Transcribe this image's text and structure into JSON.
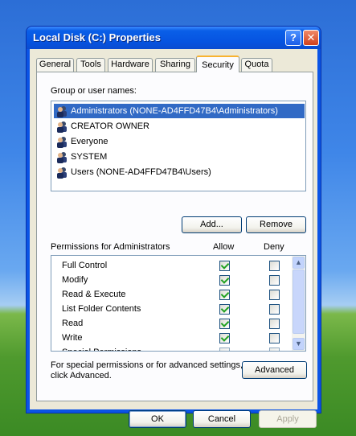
{
  "window": {
    "title": "Local Disk (C:) Properties",
    "help_glyph": "?",
    "close_glyph": "✕"
  },
  "tabs": [
    {
      "label": "General"
    },
    {
      "label": "Tools"
    },
    {
      "label": "Hardware"
    },
    {
      "label": "Sharing"
    },
    {
      "label": "Security",
      "active": true
    },
    {
      "label": "Quota"
    }
  ],
  "groups": {
    "label": "Group or user names:",
    "items": [
      {
        "name": "Administrators (NONE-AD4FFD47B4\\Administrators)",
        "selected": true
      },
      {
        "name": "CREATOR OWNER"
      },
      {
        "name": "Everyone"
      },
      {
        "name": "SYSTEM"
      },
      {
        "name": "Users (NONE-AD4FFD47B4\\Users)"
      }
    ],
    "add_label": "Add...",
    "remove_label": "Remove"
  },
  "permissions": {
    "label": "Permissions for Administrators",
    "allow_label": "Allow",
    "deny_label": "Deny",
    "rows": [
      {
        "name": "Full Control",
        "allow": true,
        "deny": false
      },
      {
        "name": "Modify",
        "allow": true,
        "deny": false
      },
      {
        "name": "Read & Execute",
        "allow": true,
        "deny": false
      },
      {
        "name": "List Folder Contents",
        "allow": true,
        "deny": false
      },
      {
        "name": "Read",
        "allow": true,
        "deny": false
      },
      {
        "name": "Write",
        "allow": true,
        "deny": false
      },
      {
        "name": "Special Permissions",
        "allow": false,
        "deny": false
      }
    ],
    "scroll_up": "▲",
    "scroll_down": "▼"
  },
  "advanced": {
    "text_line1": "For special permissions or for advanced settings,",
    "text_line2": "click Advanced.",
    "button_label": "Advanced"
  },
  "footer": {
    "ok_label": "OK",
    "cancel_label": "Cancel",
    "apply_label": "Apply"
  },
  "colors": {
    "titlebar": "#0a54e6",
    "selection": "#316ac5",
    "dialog_bg": "#ece9d8",
    "tab_highlight": "#f8b330"
  }
}
